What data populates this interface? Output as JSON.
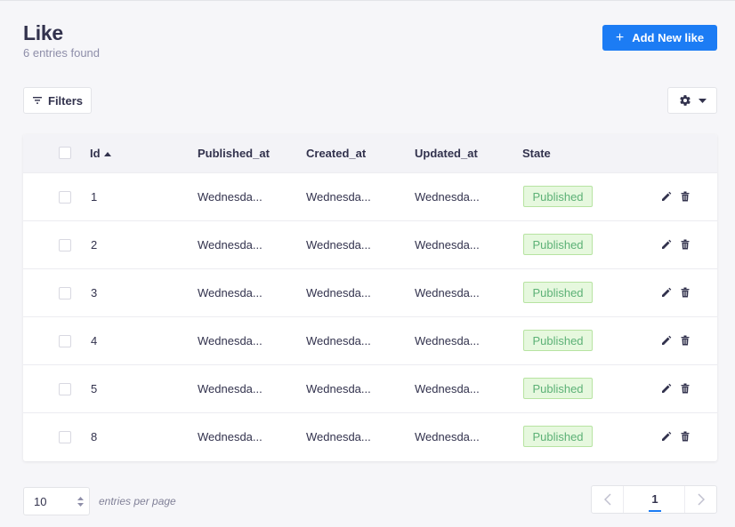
{
  "header": {
    "title": "Like",
    "subtitle": "6 entries found",
    "add_button_label": "Add New like"
  },
  "toolbar": {
    "filters_label": "Filters"
  },
  "table": {
    "columns": {
      "id": "Id",
      "published_at": "Published_at",
      "created_at": "Created_at",
      "updated_at": "Updated_at",
      "state": "State"
    },
    "rows": [
      {
        "id": "1",
        "published_at": "Wednesda...",
        "created_at": "Wednesda...",
        "updated_at": "Wednesda...",
        "state": "Published"
      },
      {
        "id": "2",
        "published_at": "Wednesda...",
        "created_at": "Wednesda...",
        "updated_at": "Wednesda...",
        "state": "Published"
      },
      {
        "id": "3",
        "published_at": "Wednesda...",
        "created_at": "Wednesda...",
        "updated_at": "Wednesda...",
        "state": "Published"
      },
      {
        "id": "4",
        "published_at": "Wednesda...",
        "created_at": "Wednesda...",
        "updated_at": "Wednesda...",
        "state": "Published"
      },
      {
        "id": "5",
        "published_at": "Wednesda...",
        "created_at": "Wednesda...",
        "updated_at": "Wednesda...",
        "state": "Published"
      },
      {
        "id": "8",
        "published_at": "Wednesda...",
        "created_at": "Wednesda...",
        "updated_at": "Wednesda...",
        "state": "Published"
      }
    ]
  },
  "footer": {
    "per_page_value": "10",
    "per_page_label": "entries per page",
    "current_page": "1"
  },
  "colors": {
    "primary": "#1c7cf4",
    "badge_bg": "#e6f8de",
    "badge_text": "#5cb176"
  }
}
